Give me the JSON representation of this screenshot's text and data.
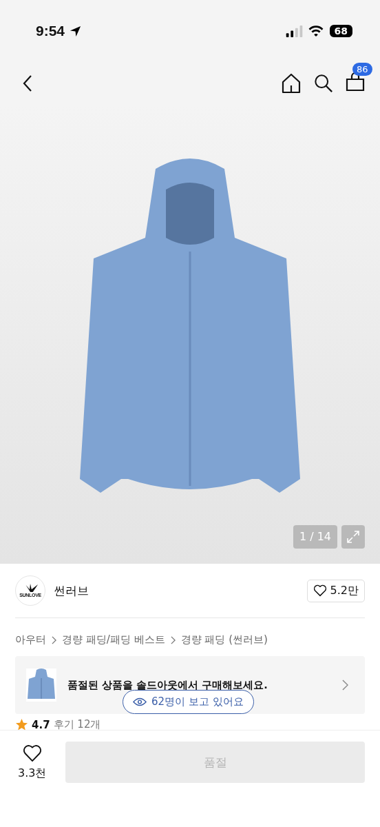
{
  "status_bar": {
    "time": "9:54",
    "battery": "68"
  },
  "nav": {
    "cart_badge": "86"
  },
  "gallery": {
    "counter": "1 / 14"
  },
  "brand": {
    "logo_text": "SUNLOVE",
    "name": "썬러브",
    "likes": "5.2만"
  },
  "breadcrumb": [
    "아우터",
    "경량 패딩/패딩 베스트",
    "경량 패딩 (썬러브)"
  ],
  "soldout_banner": {
    "text": "품절된 상품을 솔드아웃에서 구매해보세요."
  },
  "viewers": {
    "text": "62명이 보고 있어요"
  },
  "rating": {
    "score": "4.7",
    "reviews": "후기 12개"
  },
  "bottom_bar": {
    "likes": "3.3천",
    "button": {
      "label": "품절",
      "disabled": true
    }
  }
}
